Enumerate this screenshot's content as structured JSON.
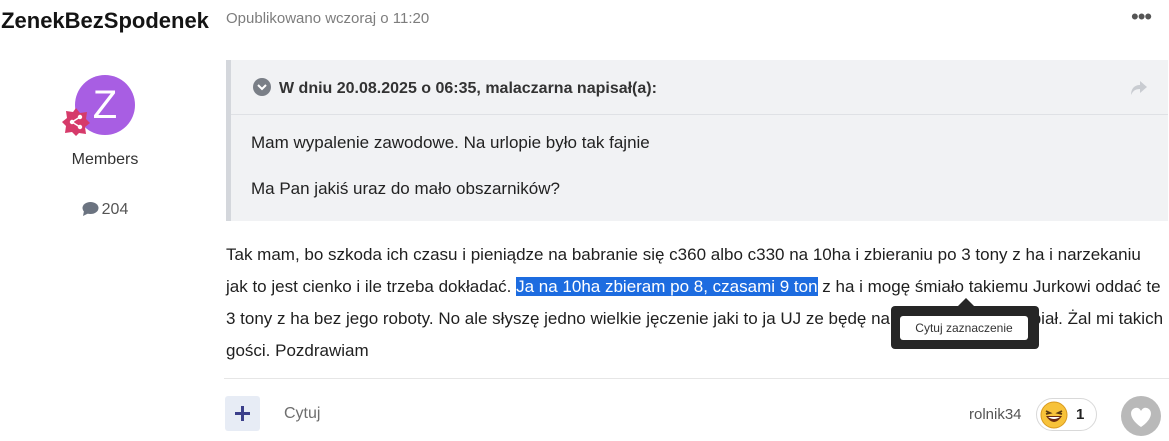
{
  "author": {
    "name": "ZenekBezSpodenek",
    "avatar_letter": "Z",
    "group": "Members",
    "post_count": "204",
    "avatar_color": "#a85ee3",
    "badge_color": "#d63a6a"
  },
  "post": {
    "meta": "Opublikowano wczoraj o 11:20",
    "more_label": "•••"
  },
  "quote": {
    "header": "W dniu 20.08.2025 o 06:35, malaczarna napisał(a):",
    "lines": [
      "Mam wypalenie zawodowe. Na urlopie było tak fajnie",
      "Ma Pan jakiś uraz do mało obszarników?"
    ]
  },
  "body": {
    "before": "Tak mam, bo szkoda ich czasu i pieniądze na babranie się c360 albo c330 na 10ha i zbieraniu po 3 tony z ha i narzekaniu jak to jest cienko i ile trzeba dokładać. ",
    "selected": "Ja na 10ha zbieram po 8, czasami 9 ton",
    "after": " z ha i mogę śmiało takiemu Jurkowi oddać te 3 tony z ha bez jego roboty. No ale słyszę jedno wielkie jęczenie jaki to ja UJ ze będę na nim żerował i zarabiał. Żal mi takich gości. Pozdrawiam",
    "selection_color": "#1d6ce0"
  },
  "popup": {
    "button_label": "Cytuj zaznaczenie"
  },
  "footer": {
    "plus_label": "+",
    "quote_label": "Cytuj",
    "reactor": "rolnik34",
    "reaction_count": "1",
    "reaction_icon": "laughing-emoji-icon"
  }
}
